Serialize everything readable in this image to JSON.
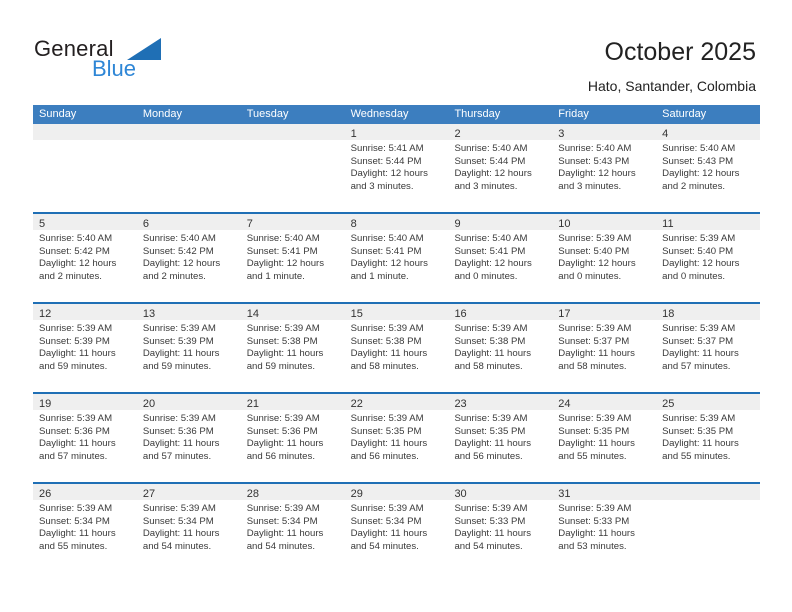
{
  "brand": {
    "name_part1": "General",
    "name_part2": "Blue",
    "triangle_icon": "triangle-icon",
    "accent_color": "#2e86d6",
    "header_color": "#3c7ebf"
  },
  "header": {
    "title": "October 2025",
    "subtitle": "Hato, Santander, Colombia"
  },
  "calendar": {
    "weekday_headers": [
      "Sunday",
      "Monday",
      "Tuesday",
      "Wednesday",
      "Thursday",
      "Friday",
      "Saturday"
    ],
    "weeks": [
      [
        {
          "day": "",
          "lines": []
        },
        {
          "day": "",
          "lines": []
        },
        {
          "day": "",
          "lines": []
        },
        {
          "day": "1",
          "lines": [
            "Sunrise: 5:41 AM",
            "Sunset: 5:44 PM",
            "Daylight: 12 hours",
            "and 3 minutes."
          ]
        },
        {
          "day": "2",
          "lines": [
            "Sunrise: 5:40 AM",
            "Sunset: 5:44 PM",
            "Daylight: 12 hours",
            "and 3 minutes."
          ]
        },
        {
          "day": "3",
          "lines": [
            "Sunrise: 5:40 AM",
            "Sunset: 5:43 PM",
            "Daylight: 12 hours",
            "and 3 minutes."
          ]
        },
        {
          "day": "4",
          "lines": [
            "Sunrise: 5:40 AM",
            "Sunset: 5:43 PM",
            "Daylight: 12 hours",
            "and 2 minutes."
          ]
        }
      ],
      [
        {
          "day": "5",
          "lines": [
            "Sunrise: 5:40 AM",
            "Sunset: 5:42 PM",
            "Daylight: 12 hours",
            "and 2 minutes."
          ]
        },
        {
          "day": "6",
          "lines": [
            "Sunrise: 5:40 AM",
            "Sunset: 5:42 PM",
            "Daylight: 12 hours",
            "and 2 minutes."
          ]
        },
        {
          "day": "7",
          "lines": [
            "Sunrise: 5:40 AM",
            "Sunset: 5:41 PM",
            "Daylight: 12 hours",
            "and 1 minute."
          ]
        },
        {
          "day": "8",
          "lines": [
            "Sunrise: 5:40 AM",
            "Sunset: 5:41 PM",
            "Daylight: 12 hours",
            "and 1 minute."
          ]
        },
        {
          "day": "9",
          "lines": [
            "Sunrise: 5:40 AM",
            "Sunset: 5:41 PM",
            "Daylight: 12 hours",
            "and 0 minutes."
          ]
        },
        {
          "day": "10",
          "lines": [
            "Sunrise: 5:39 AM",
            "Sunset: 5:40 PM",
            "Daylight: 12 hours",
            "and 0 minutes."
          ]
        },
        {
          "day": "11",
          "lines": [
            "Sunrise: 5:39 AM",
            "Sunset: 5:40 PM",
            "Daylight: 12 hours",
            "and 0 minutes."
          ]
        }
      ],
      [
        {
          "day": "12",
          "lines": [
            "Sunrise: 5:39 AM",
            "Sunset: 5:39 PM",
            "Daylight: 11 hours",
            "and 59 minutes."
          ]
        },
        {
          "day": "13",
          "lines": [
            "Sunrise: 5:39 AM",
            "Sunset: 5:39 PM",
            "Daylight: 11 hours",
            "and 59 minutes."
          ]
        },
        {
          "day": "14",
          "lines": [
            "Sunrise: 5:39 AM",
            "Sunset: 5:38 PM",
            "Daylight: 11 hours",
            "and 59 minutes."
          ]
        },
        {
          "day": "15",
          "lines": [
            "Sunrise: 5:39 AM",
            "Sunset: 5:38 PM",
            "Daylight: 11 hours",
            "and 58 minutes."
          ]
        },
        {
          "day": "16",
          "lines": [
            "Sunrise: 5:39 AM",
            "Sunset: 5:38 PM",
            "Daylight: 11 hours",
            "and 58 minutes."
          ]
        },
        {
          "day": "17",
          "lines": [
            "Sunrise: 5:39 AM",
            "Sunset: 5:37 PM",
            "Daylight: 11 hours",
            "and 58 minutes."
          ]
        },
        {
          "day": "18",
          "lines": [
            "Sunrise: 5:39 AM",
            "Sunset: 5:37 PM",
            "Daylight: 11 hours",
            "and 57 minutes."
          ]
        }
      ],
      [
        {
          "day": "19",
          "lines": [
            "Sunrise: 5:39 AM",
            "Sunset: 5:36 PM",
            "Daylight: 11 hours",
            "and 57 minutes."
          ]
        },
        {
          "day": "20",
          "lines": [
            "Sunrise: 5:39 AM",
            "Sunset: 5:36 PM",
            "Daylight: 11 hours",
            "and 57 minutes."
          ]
        },
        {
          "day": "21",
          "lines": [
            "Sunrise: 5:39 AM",
            "Sunset: 5:36 PM",
            "Daylight: 11 hours",
            "and 56 minutes."
          ]
        },
        {
          "day": "22",
          "lines": [
            "Sunrise: 5:39 AM",
            "Sunset: 5:35 PM",
            "Daylight: 11 hours",
            "and 56 minutes."
          ]
        },
        {
          "day": "23",
          "lines": [
            "Sunrise: 5:39 AM",
            "Sunset: 5:35 PM",
            "Daylight: 11 hours",
            "and 56 minutes."
          ]
        },
        {
          "day": "24",
          "lines": [
            "Sunrise: 5:39 AM",
            "Sunset: 5:35 PM",
            "Daylight: 11 hours",
            "and 55 minutes."
          ]
        },
        {
          "day": "25",
          "lines": [
            "Sunrise: 5:39 AM",
            "Sunset: 5:35 PM",
            "Daylight: 11 hours",
            "and 55 minutes."
          ]
        }
      ],
      [
        {
          "day": "26",
          "lines": [
            "Sunrise: 5:39 AM",
            "Sunset: 5:34 PM",
            "Daylight: 11 hours",
            "and 55 minutes."
          ]
        },
        {
          "day": "27",
          "lines": [
            "Sunrise: 5:39 AM",
            "Sunset: 5:34 PM",
            "Daylight: 11 hours",
            "and 54 minutes."
          ]
        },
        {
          "day": "28",
          "lines": [
            "Sunrise: 5:39 AM",
            "Sunset: 5:34 PM",
            "Daylight: 11 hours",
            "and 54 minutes."
          ]
        },
        {
          "day": "29",
          "lines": [
            "Sunrise: 5:39 AM",
            "Sunset: 5:34 PM",
            "Daylight: 11 hours",
            "and 54 minutes."
          ]
        },
        {
          "day": "30",
          "lines": [
            "Sunrise: 5:39 AM",
            "Sunset: 5:33 PM",
            "Daylight: 11 hours",
            "and 54 minutes."
          ]
        },
        {
          "day": "31",
          "lines": [
            "Sunrise: 5:39 AM",
            "Sunset: 5:33 PM",
            "Daylight: 11 hours",
            "and 53 minutes."
          ]
        },
        {
          "day": "",
          "lines": []
        }
      ]
    ]
  }
}
